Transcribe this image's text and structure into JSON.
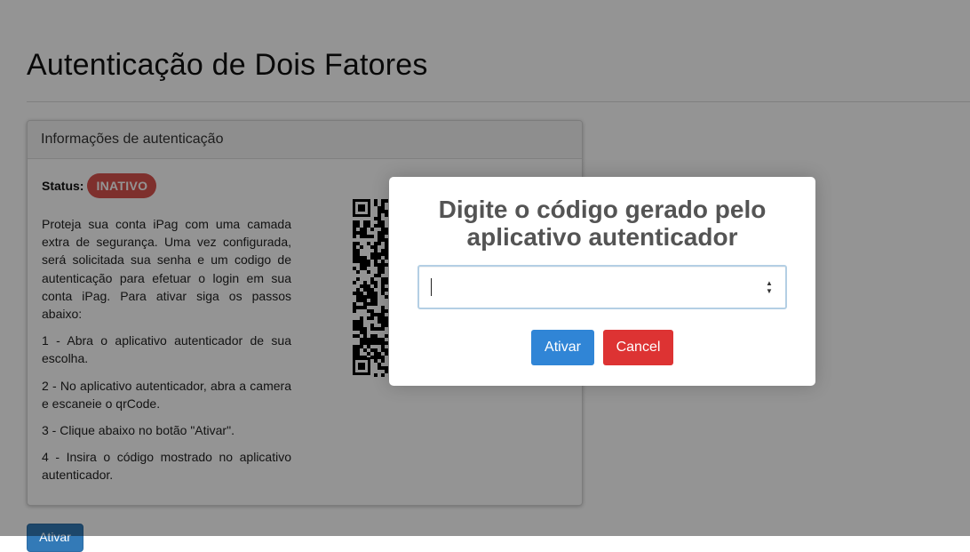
{
  "page": {
    "title": "Autenticação de Dois Fatores",
    "bottom_button_label": "Ativar"
  },
  "panel": {
    "heading": "Informações de autenticação",
    "status_label": "Status:",
    "status_value": "INATIVO",
    "intro": "Proteja sua conta iPag com uma camada extra de segurança. Uma vez configurada, será solicitada sua senha e um codigo de autenticação para efetuar o login em sua conta iPag. Para ativar siga os passos abaixo:",
    "steps": [
      "1 - Abra o aplicativo autenticador de sua escolha.",
      "2 - No aplicativo autenticador, abra a camera e escaneie o qrCode.",
      "3 - Clique abaixo no botão \"Ativar\".",
      "4 - Insira o código mostrado no aplicativo autenticador."
    ]
  },
  "modal": {
    "title": "Digite o código gerado pelo aplicativo autenticador",
    "input_value": "",
    "confirm_label": "Ativar",
    "cancel_label": "Cancel"
  },
  "colors": {
    "status_badge": "#d9534f",
    "confirm_button": "#3085d6",
    "cancel_button": "#dd3333",
    "primary_button": "#337ab7"
  }
}
